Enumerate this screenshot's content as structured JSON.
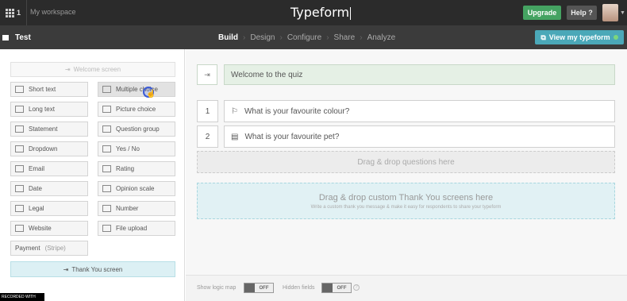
{
  "topbar": {
    "workspace_count": "1",
    "workspace_label": "My workspace",
    "logo": "Typeform",
    "upgrade_label": "Upgrade",
    "help_label": "Help ?"
  },
  "subbar": {
    "form_title": "Test",
    "steps": [
      "Build",
      "Design",
      "Configure",
      "Share",
      "Analyze"
    ],
    "active_step": "Build",
    "view_button": "View my typeform"
  },
  "sidebar": {
    "welcome_screen": "Welcome screen",
    "question_types": [
      {
        "label": "Short text",
        "icon": "short-text-icon"
      },
      {
        "label": "Multiple choice",
        "icon": "multiple-choice-icon"
      },
      {
        "label": "Long text",
        "icon": "long-text-icon"
      },
      {
        "label": "Picture choice",
        "icon": "picture-choice-icon"
      },
      {
        "label": "Statement",
        "icon": "statement-icon"
      },
      {
        "label": "Question group",
        "icon": "question-group-icon"
      },
      {
        "label": "Dropdown",
        "icon": "dropdown-icon"
      },
      {
        "label": "Yes / No",
        "icon": "yes-no-icon"
      },
      {
        "label": "Email",
        "icon": "email-icon"
      },
      {
        "label": "Rating",
        "icon": "rating-icon"
      },
      {
        "label": "Date",
        "icon": "date-icon"
      },
      {
        "label": "Opinion scale",
        "icon": "opinion-scale-icon"
      },
      {
        "label": "Legal",
        "icon": "legal-icon"
      },
      {
        "label": "Number",
        "icon": "number-icon"
      },
      {
        "label": "Website",
        "icon": "website-icon"
      },
      {
        "label": "File upload",
        "icon": "file-upload-icon"
      }
    ],
    "payment": {
      "label": "Payment",
      "sub": "(Stripe)"
    },
    "thankyou_screen": "Thank You screen",
    "recording_text": "RECORDED WITH"
  },
  "main": {
    "welcome": {
      "number": "1",
      "text": "Welcome to the quiz"
    },
    "questions": [
      {
        "number": "1",
        "text": "What is your favourite colour?"
      },
      {
        "number": "2",
        "text": "What is your favourite pet?"
      }
    ],
    "drop_questions": "Drag & drop questions here",
    "drop_thankyou_title": "Drag & drop custom Thank You screens here",
    "drop_thankyou_sub": "Write a custom thank you message & make it easy for respondents to share your typeform"
  },
  "footer": {
    "logic_map_label": "Show logic map",
    "logic_map_state": "OFF",
    "hidden_fields_label": "Hidden fields",
    "hidden_fields_state": "OFF",
    "info_glyph": "?"
  },
  "colors": {
    "topbar": "#2b2b2b",
    "subbar": "#3b3b3b",
    "upgrade": "#45a362",
    "view_button": "#4ba8b8",
    "welcome_bar": "#e5f0e5",
    "thankyou_drop": "#e1f1f4"
  }
}
